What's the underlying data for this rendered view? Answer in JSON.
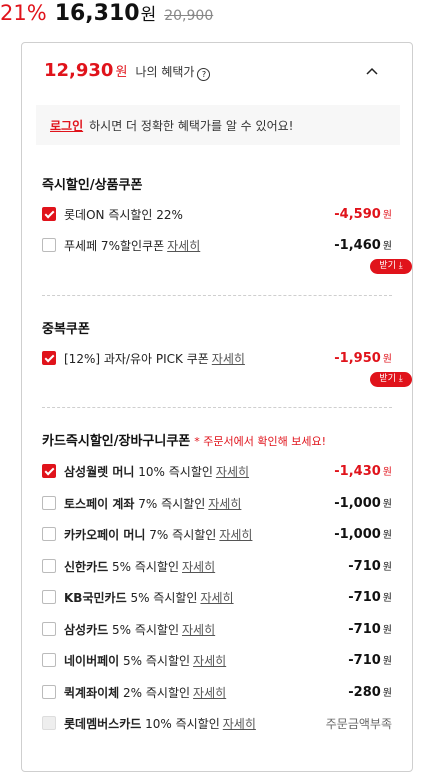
{
  "price": {
    "discount_rate": "21%",
    "sale_price": "16,310",
    "won": "원",
    "original_price": "20,900"
  },
  "panel": {
    "total_benefit_price": "12,930",
    "won": "원",
    "benefit_label": "나의 혜택가",
    "help_icon": "?",
    "collapse_icon": "chevron-up-icon"
  },
  "login_banner": {
    "link": "로그인",
    "text": "하시면 더 정확한 혜택가를 알 수 있어요!"
  },
  "download_label": "받기 ⤓",
  "detail_label": "자세히",
  "won": "원",
  "sections": {
    "instant": {
      "title": "즉시할인/상품쿠폰",
      "items": [
        {
          "checked": true,
          "label": "롯데ON 즉시할인 22%",
          "amount": "-4,590",
          "red": true
        },
        {
          "checked": false,
          "label": "푸세페 7%할인쿠폰",
          "amount": "-1,460",
          "red": false
        }
      ]
    },
    "duplicate": {
      "title": "중복쿠폰",
      "items": [
        {
          "checked": true,
          "label": "[12%] 과자/유아 PICK 쿠폰",
          "amount": "-1,950",
          "red": true
        }
      ]
    },
    "card": {
      "title": "카드즉시할인/장바구니쿠폰",
      "note": "* 주문서에서 확인해 보세요!",
      "items": [
        {
          "checked": true,
          "bold": "삼성월렛 머니",
          "label": "10% 즉시할인",
          "amount": "-1,430",
          "red": true
        },
        {
          "checked": false,
          "bold": "토스페이 계좌",
          "label": "7% 즉시할인",
          "amount": "-1,000",
          "red": false
        },
        {
          "checked": false,
          "bold": "카카오페이 머니",
          "label": "7% 즉시할인",
          "amount": "-1,000",
          "red": false
        },
        {
          "checked": false,
          "bold": "신한카드",
          "label": "5% 즉시할인",
          "amount": "-710",
          "red": false
        },
        {
          "checked": false,
          "bold": "KB국민카드",
          "label": "5% 즉시할인",
          "amount": "-710",
          "red": false
        },
        {
          "checked": false,
          "bold": "삼성카드",
          "label": "5% 즉시할인",
          "amount": "-710",
          "red": false
        },
        {
          "checked": false,
          "bold": "네이버페이",
          "label": "5% 즉시할인",
          "amount": "-710",
          "red": false
        },
        {
          "checked": false,
          "bold": "퀵계좌이체",
          "label": "2% 즉시할인",
          "amount": "-280",
          "red": false
        },
        {
          "checked": false,
          "disabled": true,
          "bold": "롯데멤버스카드",
          "label": "10% 즉시할인",
          "status": "주문금액부족"
        }
      ]
    }
  }
}
